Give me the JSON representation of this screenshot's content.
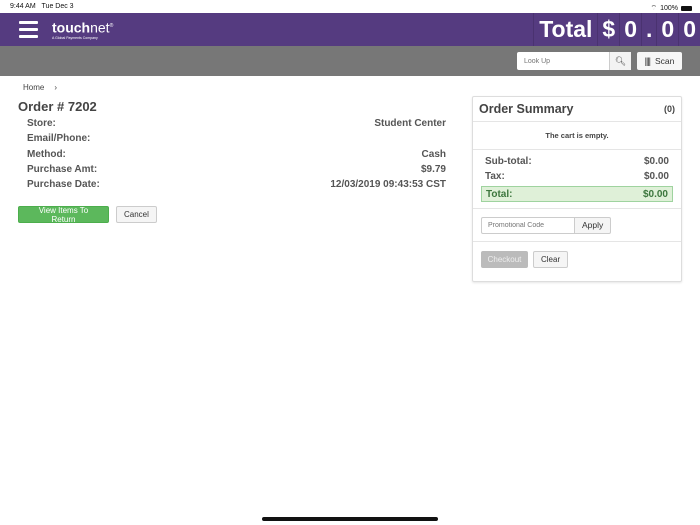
{
  "status_bar": {
    "time": "9:44 AM",
    "date": "Tue Dec 3",
    "battery": "100%"
  },
  "header": {
    "logo_main": "touch",
    "logo_accent": "net",
    "logo_reg": "®",
    "logo_sub": "A Global Payments Company",
    "total_label": "Total",
    "total_digits": [
      "$",
      "0",
      ".",
      "0",
      "0"
    ]
  },
  "toolbar": {
    "lookup_placeholder": "Look Up",
    "scan_label": "Scan"
  },
  "breadcrumb": {
    "home": "Home",
    "sep": "›"
  },
  "order": {
    "title": "Order # 7202",
    "fields": [
      {
        "label": "Store:",
        "value": "Student Center"
      },
      {
        "label": "Email/Phone:",
        "value": ""
      },
      {
        "label": "Method:",
        "value": "Cash"
      },
      {
        "label": "Purchase Amt:",
        "value": "$9.79"
      },
      {
        "label": "Purchase Date:",
        "value": "12/03/2019 09:43:53 CST"
      }
    ],
    "view_items_label": "View Items To Return",
    "cancel_label": "Cancel"
  },
  "summary": {
    "title": "Order Summary",
    "count": "(0)",
    "empty_text": "The cart is empty.",
    "subtotal_label": "Sub-total:",
    "subtotal": "$0.00",
    "tax_label": "Tax:",
    "tax": "$0.00",
    "total_label": "Total:",
    "total": "$0.00",
    "promo_placeholder": "Promotional Code",
    "apply_label": "Apply",
    "checkout_label": "Checkout",
    "clear_label": "Clear"
  }
}
